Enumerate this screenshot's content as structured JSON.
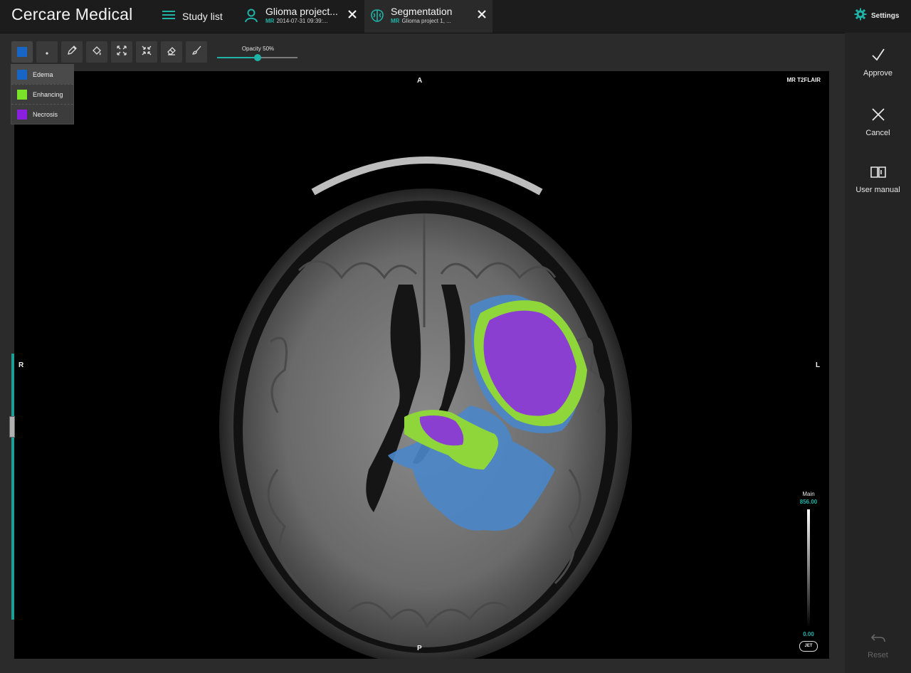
{
  "app": {
    "brand": "Cercare Medical"
  },
  "nav": {
    "study_list_label": "Study list"
  },
  "tabs": [
    {
      "title": "Glioma project...",
      "modality": "MR",
      "subtitle": "2014-07-31 09:39:..."
    },
    {
      "title": "Segmentation",
      "modality": "MR",
      "subtitle": "Glioma project 1, ..."
    }
  ],
  "settings": {
    "label": "Settings"
  },
  "toolbar": {
    "tools": [
      "color-picker",
      "brush-size",
      "pencil",
      "fill",
      "expand",
      "shrink",
      "erase",
      "brush"
    ],
    "opacity_label": "Opacity 50%",
    "opacity_value": 0.5
  },
  "labels": [
    {
      "name": "Edema",
      "color": "#1766c6"
    },
    {
      "name": "Enhancing",
      "color": "#7be22a"
    },
    {
      "name": "Necrosis",
      "color": "#8a1fe0"
    }
  ],
  "viewer": {
    "series": "MR T2FLAIR",
    "orient_top": "A",
    "orient_bottom": "P",
    "orient_left": "R",
    "orient_right": "L",
    "window_name": "Main",
    "window_max": "856.00",
    "window_min": "0.00",
    "lut": "JET"
  },
  "side_actions": {
    "approve": "Approve",
    "cancel": "Cancel",
    "manual": "User manual",
    "reset": "Reset"
  },
  "colors": {
    "accent": "#1fb3a8",
    "edema": "#4a86c8",
    "enhancing": "#8fd63a",
    "necrosis": "#8a3fd0"
  }
}
